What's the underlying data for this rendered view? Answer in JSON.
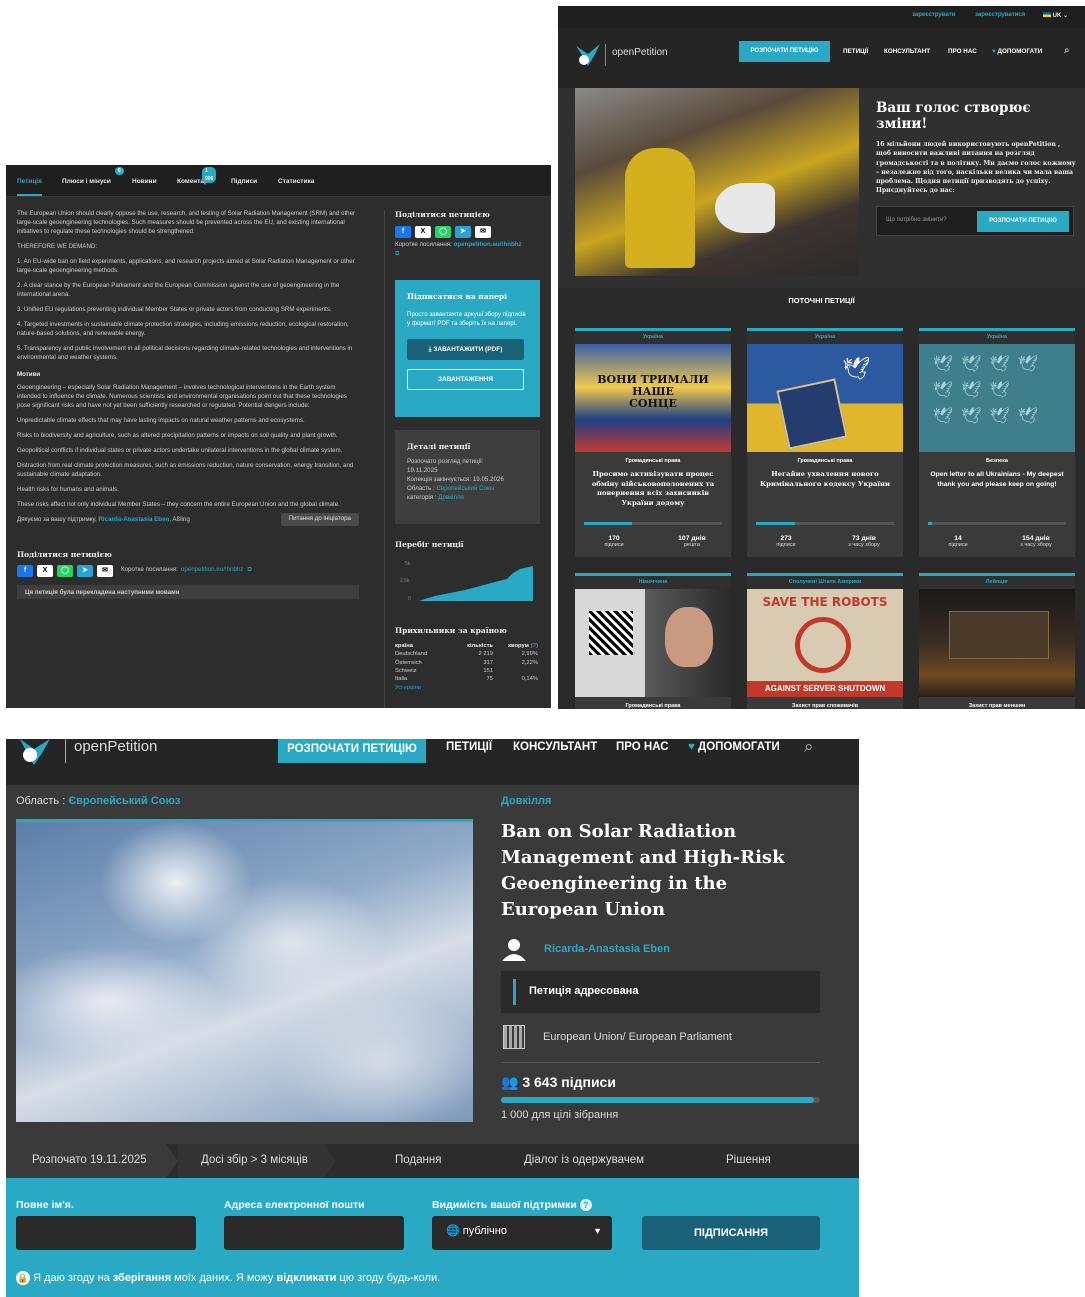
{
  "colors": {
    "accent": "#2aa9c5",
    "dark": "#2d2d2d",
    "navy_button": "#1b6178"
  },
  "panelA": {
    "tabs": [
      "Петиція",
      "Плюси і мінуси",
      "Новини",
      "Коментарі",
      "Підписи",
      "Статистика"
    ],
    "tab_badges": {
      "pros_cons": "6",
      "comments": "1 906"
    },
    "intro": "The European Union should clearly oppose the use, research, and testing of Solar Radiation Management (SRM) and other large-scale geoengineering technologies. Such measures should be prevented across the EU, and existing international initiatives to regulate these technologies should be strengthened.",
    "demand_heading": "THEREFORE WE DEMAND:",
    "demands": [
      "1. An EU-wide ban on field experiments, applications, and research projects aimed at Solar Radiation Management or other large-scale geoengineering methods.",
      "2. A clear stance by the European Parliament and the European Commission against the use of geoengineering in the international arena.",
      "3. Unified EU regulations preventing individual Member States or private actors from conducting SRM experiments.",
      "4. Targeted investments in sustainable climate protection strategies, including emissions reduction, ecological restoration, nature-based solutions, and renewable energy.",
      "5. Transparency and public involvement in all political decisions regarding climate-related technologies and interventions in environmental and weather systems."
    ],
    "motives_heading": "Мотиви",
    "motives": [
      "Geoengineering – especially Solar Radiation Management – involves technological interventions in the Earth system intended to influence the climate. Numerous scientists and environmental organisations point out that these technologies pose significant risks and have not yet been sufficiently researched or regulated. Potential dangers include:",
      "Unpredictable climate effects that may have lasting impacts on natural weather patterns and ecosystems.",
      "Risks to biodiversity and agriculture, such as altered precipitation patterns or impacts on soil quality and plant growth.",
      "Geopolitical conflicts if individual states or private actors undertake unilateral interventions in the global climate system.",
      "Distraction from real climate protection measures, such as emissions reduction, nature conservation, energy transition, and sustainable climate adaptation.",
      "Health risks for humans and animals.",
      "These risks affect not only individual Member States – they concern the entire European Union and the global climate."
    ],
    "thanks_prefix": "Дякуємо за вашу підтримку,",
    "thanks_name": "Ricarda-Anastasia Eben",
    "thanks_place": ", Aßling",
    "question_btn": "Питання до ініціатора",
    "share_heading": "Поділитися петицією",
    "short_link_label": "Коротке посилання:",
    "short_link": "openpetition.eu/!hnbhz",
    "translated_note": "Ця петиція була перекладена наступними мовами",
    "side_share_heading": "Поділитися петицією",
    "paper": {
      "title": "Підписатися на папері",
      "text": "Просто завантажте аркуші збору підписів у форматі PDF та зберіть їх на папері.",
      "btn_pdf": "ЗАВАНТАЖИТИ (PDF)",
      "btn_dl": "ЗАВАНТАЖЕННЯ"
    },
    "details": {
      "title": "Деталі петиції",
      "started_label": "Розпочато розгляд петиції:",
      "started": "19.11.2025",
      "ends": "Колекція закінчується: 19.05.2026",
      "area_label": "Область :",
      "area": "Європейський Союз",
      "cat_label": "категорія :",
      "cat": "Довкілля"
    },
    "chart_heading": "Перебіг петиції",
    "chart_ticks": [
      "5k",
      "2,5k",
      "0"
    ],
    "supporters": {
      "heading": "Прихильники за країною",
      "cols": [
        "країна",
        "кількість",
        "кворум"
      ],
      "q": "(?)",
      "rows": [
        [
          "Deutschland",
          "2 219",
          "2,99%"
        ],
        [
          "Österreich",
          "317",
          "2,22%"
        ],
        [
          "Schweiz",
          "151",
          ""
        ],
        [
          "Italia",
          "75",
          "0,14%"
        ]
      ],
      "all": "Усі країни"
    }
  },
  "panelB": {
    "top": {
      "register": "зареєструвати",
      "login": "зареєструватися",
      "lang": "UK"
    },
    "logo": "openPetition",
    "nav": {
      "start": "РОЗПОЧАТИ ПЕТИЦІЮ",
      "petitions": "ПЕТИЦІЇ",
      "consultant": "КОНСУЛЬТАНТ",
      "about": "ПРО НАС",
      "donate": "ДОПОМОГАТИ"
    },
    "hero": {
      "title": "Ваш голос створює зміни!",
      "text": "16 мільйони людей використовують openPetition , щоб виносити важливі питання на розгляд громадськості та в політику. Ми даємо голос кожному – незалежно від того, наскільки велика чи мала ваша проблема. Щодня петиції призводять до успіху. Приєднуйтесь до нас:",
      "placeholder": "Що потрібно змінити?",
      "btn": "РОЗПОЧАТИ ПЕТИЦІЮ"
    },
    "current": "ПОТОЧНІ ПЕТИЦІЇ",
    "cards": [
      {
        "region": "Україна",
        "cat": "Громадянські права",
        "title": "Просимо активізувати процес обміну військовополонених та повернення всіх захисників України додому",
        "progress": 0.35,
        "n1": "170",
        "l1": "підписи",
        "n2": "107 днів",
        "l2": "решта"
      },
      {
        "region": "Україна",
        "cat": "Громадянські права",
        "title": "Негайне ухвалення нового Кримінального кодексу України",
        "progress": 0.28,
        "n1": "273",
        "l1": "підписи",
        "n2": "73 днів",
        "l2": "з часу збору"
      },
      {
        "region": "Україна",
        "cat": "Безпека",
        "title": "Open letter to all Ukrainians - My deepest thank you and please keep on going!",
        "progress": 0.03,
        "n1": "14",
        "l1": "підписи",
        "n2": "154 днів",
        "l2": "з часу збору"
      },
      {
        "region": "Німеччина",
        "cat": "Громадянські права"
      },
      {
        "region": "Сполучені Штати Америки",
        "cat": "Захист прав споживачів",
        "poster_top": "SAVE THE ROBOTS",
        "poster_bottom": "AGAINST SERVER SHUTDOWN"
      },
      {
        "region": "Лейпциг",
        "cat": "Захист прав меншин"
      }
    ],
    "banner_words": [
      "вони тримали",
      "наше",
      "сонце"
    ]
  },
  "panelC": {
    "logo": "openPetition",
    "nav": {
      "start": "РОЗПОЧАТИ ПЕТИЦІЮ",
      "petitions": "ПЕТИЦІЇ",
      "consultant": "КОНСУЛЬТАНТ",
      "about": "ПРО НАС",
      "donate": "ДОПОМОГАТИ"
    },
    "area_label": "Область :",
    "area": "Європейський Союз",
    "category": "Довкілля",
    "title": "Ban on Solar Radiation Management and High-Risk Geoengineering in the European Union",
    "author": "Ricarda-Anastasia Eben",
    "addressed": "Петиція адресована",
    "recipient": "European Union/ European Parliament",
    "signatures": "3 643 підписи",
    "progress": 0.98,
    "goal": "1 000 для цілі зібрання",
    "steps": [
      "Розпочато 19.11.2025",
      "Досі збір > 3 місяців",
      "Подання",
      "Діалог із одержувачем",
      "Рішення"
    ],
    "form": {
      "name": "Повне ім'я.",
      "email": "Адреса електронної пошти",
      "visibility": "Видимість вашої підтримки",
      "visibility_value": "публічно",
      "submit": "ПІДПИСАННЯ",
      "consent_a": "Я даю згоду на ",
      "consent_b": "зберігання",
      "consent_c": " моїх даних. Я можу ",
      "consent_d": "відкликати",
      "consent_e": " цю згоду будь-коли."
    }
  }
}
